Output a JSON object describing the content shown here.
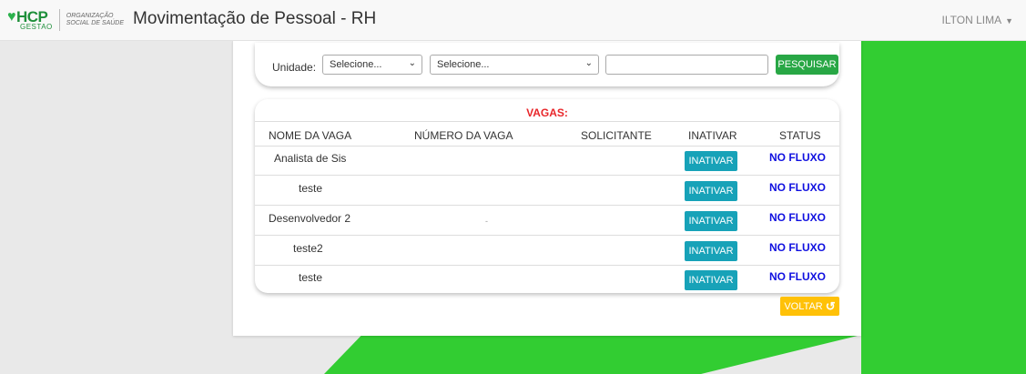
{
  "colors": {
    "accent_green": "#32cd32",
    "search_button": "#28a745",
    "inativar_button": "#17a2b8",
    "voltar_button": "#ffc107",
    "status_text": "#1010e0",
    "caption_red": "#e8262a"
  },
  "header": {
    "logo_text": "HCP",
    "logo_sub": "GESTAO",
    "logo_org_line1": "ORGANIZAÇÃO",
    "logo_org_line2": "SOCIAL DE SAÚDE",
    "title": "Movimentação de Pessoal - RH",
    "user_name": "ILTON LIMA"
  },
  "filter": {
    "label": "Unidade:",
    "select1_value": "Selecione...",
    "select2_value": "Selecione...",
    "text_value": "",
    "search_label": "PESQUISAR"
  },
  "table": {
    "caption": "VAGAS:",
    "columns": [
      "NOME DA VAGA",
      "NÚMERO DA VAGA",
      "SOLICITANTE",
      "INATIVAR",
      "STATUS"
    ],
    "rows": [
      {
        "name": "Analista de Sis",
        "number": "",
        "requester": "",
        "action": "INATIVAR",
        "status": "NO FLUXO"
      },
      {
        "name": "teste",
        "number": "",
        "requester": "",
        "action": "INATIVAR",
        "status": "NO FLUXO"
      },
      {
        "name": "Desenvolvedor 2",
        "number": "-",
        "requester": "",
        "action": "INATIVAR",
        "status": "NO FLUXO"
      },
      {
        "name": "teste2",
        "number": "",
        "requester": "",
        "action": "INATIVAR",
        "status": "NO FLUXO"
      },
      {
        "name": "teste",
        "number": "",
        "requester": "",
        "action": "INATIVAR",
        "status": "NO FLUXO"
      }
    ]
  },
  "back_label": "VOLTAR",
  "icons": {
    "user_caret": "caret-down-icon",
    "back": "undo-icon",
    "select_chevron": "chevron-down-icon",
    "logo": "ribbon-icon"
  }
}
